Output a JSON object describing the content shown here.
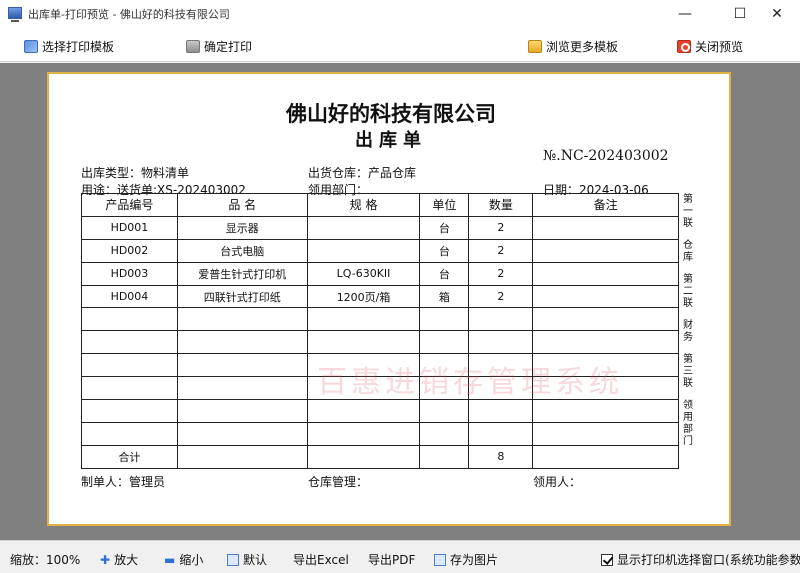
{
  "window": {
    "title": "出库单-打印预览 - 佛山好的科技有限公司",
    "min_glyph": "—",
    "max_glyph": "☐",
    "close_glyph": "✕"
  },
  "toolbar": {
    "select_template": "选择打印模板",
    "confirm_print": "确定打印",
    "browse_templates": "浏览更多模板",
    "close_preview": "关闭预览"
  },
  "document": {
    "company": "佛山好的科技有限公司",
    "title": "出库单",
    "doc_no": "№.NC-202403002",
    "out_type": "出库类型：物料清单",
    "warehouse": "出货仓库：产品仓库",
    "purpose": "用途：送货单:XS-202403002",
    "dept": "领用部门：",
    "date": "日期：2024-03-06",
    "columns": [
      "产品编号",
      "品  名",
      "规  格",
      "单位",
      "数量",
      "备注"
    ],
    "rows": [
      [
        "HD001",
        "显示器",
        "",
        "台",
        "2",
        ""
      ],
      [
        "HD002",
        "台式电脑",
        "",
        "台",
        "2",
        ""
      ],
      [
        "HD003",
        "爱普生针式打印机",
        "LQ-630KII",
        "台",
        "2",
        ""
      ],
      [
        "HD004",
        "四联针式打印纸",
        "1200页/箱",
        "箱",
        "2",
        ""
      ],
      [
        "",
        "",
        "",
        "",
        "",
        ""
      ],
      [
        "",
        "",
        "",
        "",
        "",
        ""
      ],
      [
        "",
        "",
        "",
        "",
        "",
        ""
      ],
      [
        "",
        "",
        "",
        "",
        "",
        ""
      ],
      [
        "",
        "",
        "",
        "",
        "",
        ""
      ],
      [
        "",
        "",
        "",
        "",
        "",
        ""
      ]
    ],
    "total_label": "合计",
    "total_qty": "8",
    "side_labels": [
      "第一联",
      "仓库",
      "第二联",
      "财务",
      "第三联",
      "领用部门"
    ],
    "watermark": "百惠进销存管理系统",
    "maker": "制单人：管理员",
    "warehouse_manager": "仓库管理：",
    "receiver": "领用人："
  },
  "statusbar": {
    "zoom": "缩放：100%",
    "zoom_in": "放大",
    "zoom_out": "缩小",
    "default": "默认",
    "export_excel": "导出Excel",
    "export_pdf": "导出PDF",
    "save_image": "存为图片",
    "show_printer_dialog": "显示打印机选择窗口(系统功能参数"
  }
}
